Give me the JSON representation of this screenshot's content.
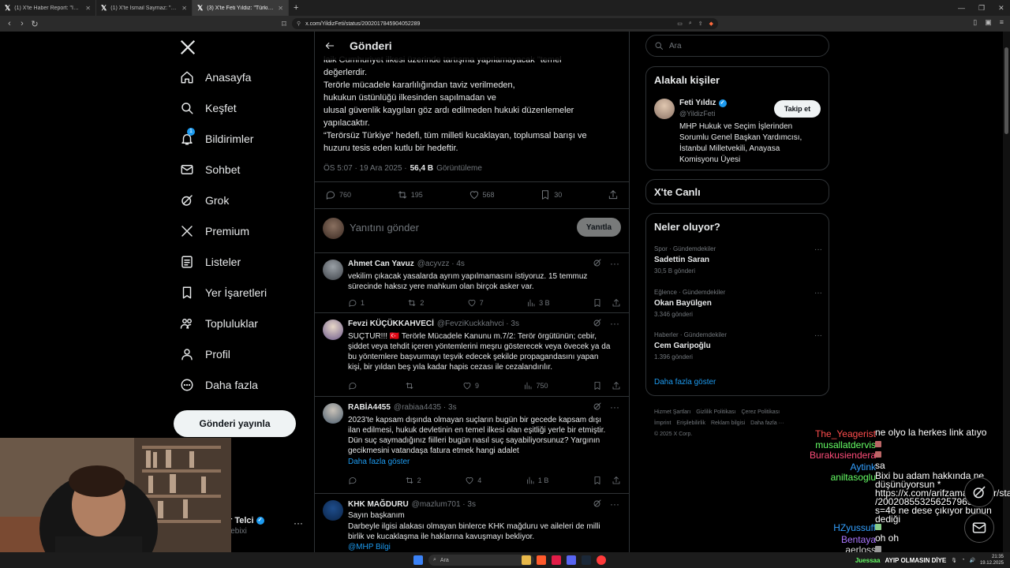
{
  "browser": {
    "tabs": [
      {
        "title": "(1) X'te Haber Report: \"İstanbul Başsavcılığı...",
        "icon": "x-logo-icon"
      },
      {
        "title": "(1) X'te İsmail Saymaz: \"Gaziantep'in...",
        "icon": "x-logo-icon"
      },
      {
        "title": "(3) X'te Feti Yıldız: \"Türkiye'nin dış...",
        "icon": "x-logo-icon",
        "active": true
      }
    ],
    "url": "x.com/YildizFeti/status/2002017845904052289"
  },
  "nav": {
    "items": [
      {
        "label": "Anasayfa",
        "icon": "home-icon"
      },
      {
        "label": "Keşfet",
        "icon": "search-icon"
      },
      {
        "label": "Bildirimler",
        "icon": "bell-icon",
        "badge": "1"
      },
      {
        "label": "Sohbet",
        "icon": "mail-icon"
      },
      {
        "label": "Grok",
        "icon": "grok-icon"
      },
      {
        "label": "Premium",
        "icon": "x-logo-icon"
      },
      {
        "label": "Listeler",
        "icon": "list-icon"
      },
      {
        "label": "Yer İşaretleri",
        "icon": "bookmark-icon"
      },
      {
        "label": "Topluluklar",
        "icon": "people-icon"
      },
      {
        "label": "Profil",
        "icon": "person-icon"
      },
      {
        "label": "Daha fazla",
        "icon": "more-circle-icon"
      }
    ],
    "post_button": "Gönderi yayınla",
    "account": {
      "name": "r Telci",
      "handle": "lebixi"
    }
  },
  "header": {
    "title": "Gönderi"
  },
  "post": {
    "lines": [
      "laik Cumhuriyet ilkesi üzerinde tartışma yapılamayacak \"temel",
      "değerlerdir.",
      "Terörle mücadele kararlılığından taviz verilmeden,",
      "hukukun üstünlüğü ilkesinden sapılmadan ve",
      "ulusal güvenlik kaygıları göz ardı edilmeden hukuki düzenlemeler",
      "yapılacaktır.",
      "“Terörsüz Türkiye” hedefi, tüm milleti kucaklayan, toplumsal barışı ve",
      "huzuru tesis eden kutlu bir hedeftir."
    ],
    "time": "ÖS 5:07 · 19 Ara 2025 ·",
    "views": "56,4 B",
    "views_label": "Görüntüleme",
    "stats": {
      "replies": "760",
      "reposts": "195",
      "likes": "568",
      "bookmarks": "30"
    }
  },
  "reply_box": {
    "placeholder": "Yanıtını gönder",
    "button": "Yanıtla"
  },
  "replies": [
    {
      "name": "Ahmet Can Yavuz",
      "handle": "@acyvzz · 4s",
      "lines": [
        "vekilim çıkacak yasalarda ayrım yapılmamasını istiyoruz. 15 temmuz",
        "sürecinde haksız yere mahkum olan birçok asker var."
      ],
      "more": "",
      "stats": {
        "replies": "1",
        "reposts": "2",
        "likes": "7",
        "views": "3 B"
      }
    },
    {
      "name": "Fevzi KÜÇÜKKAHVECİ",
      "handle": "@FevziKuckkahvci · 3s",
      "lines": [
        "SUÇTUR!!! 🇹🇷 Terörle Mücadele Kanunu m.7/2: Terör örgütünün; cebir,",
        "şiddet veya tehdit içeren yöntemlerini meşru gösterecek veya övecek ya da",
        "bu yöntemlere başvurmayı teşvik edecek şekilde propagandasını yapan",
        "kişi, bir yıldan beş yıla kadar hapis cezası ile cezalandırılır."
      ],
      "more": "",
      "stats": {
        "replies": "",
        "reposts": "",
        "likes": "9",
        "views": "750"
      }
    },
    {
      "name": "RABİA4455",
      "handle": "@rabiaa4435 · 3s",
      "lines": [
        "2023'te kapsam dışında olmayan suçların bugün bir gecede kapsam dışı",
        "ilan edilmesi, hukuk devletinin en temel ilkesi olan eşitliği yerle bir etmiştir.",
        "Dün suç saymadığınız fiilleri bugün nasıl suç sayabiliyorsunuz? Yargının",
        "gecikmesini vatandaşa fatura etmek hangi adalet"
      ],
      "more": "Daha fazla göster",
      "stats": {
        "replies": "",
        "reposts": "2",
        "likes": "4",
        "views": "1 B"
      }
    },
    {
      "name": "KHK MAĞDURU",
      "handle": "@mazlum701 · 3s",
      "lines": [
        "Sayın başkanım",
        "Darbeyle ilgisi alakası olmayan binlerce KHK mağduru ve aileleri de milli",
        "birlik ve kucaklaşma ile haklarına kavuşmayı bekliyor."
      ],
      "more": "@MHP Bilgi",
      "stats": {
        "replies": "",
        "reposts": "",
        "likes": "",
        "views": ""
      }
    }
  ],
  "right": {
    "search_placeholder": "Ara",
    "related_title": "Alakalı kişiler",
    "person": {
      "name": "Feti Yıldız",
      "handle": "@YildizFeti",
      "follow": "Takip et",
      "bio": [
        "MHP Hukuk ve Seçim İşlerinden",
        "Sorumlu Genel Başkan Yardımcısı,",
        "İstanbul Milletvekili, Anayasa",
        "Komisyonu Üyesi"
      ]
    },
    "live_title": "X'te Canlı",
    "trends_title": "Neler oluyor?",
    "trends": [
      {
        "category": "Spor · Gündemdekiler",
        "name": "Sadettin Saran",
        "count": "30,5 B gönderi"
      },
      {
        "category": "Eğlence · Gündemdekiler",
        "name": "Okan Bayülgen",
        "count": "3.346 gönderi"
      },
      {
        "category": "Haberler · Gündemdekiler",
        "name": "Cem Garipoğlu",
        "count": "1.396 gönderi"
      }
    ],
    "show_more": "Daha fazla göster",
    "footer": [
      "Hizmet Şartları",
      "Gizlilik Politikası",
      "Çerez Politikası",
      "İmprint",
      "Erişilebilirlik",
      "Reklam bilgisi",
      "Daha fazla ···",
      "© 2025 X Corp."
    ]
  },
  "chat": [
    {
      "user": "The_Yeagerist",
      "color": "#ff4d4d",
      "msg": "ne olyo la herkes link atıyo"
    },
    {
      "user": "musallatdervis",
      "color": "#66ff66",
      "msg": "[emote]"
    },
    {
      "user": "Burakusiendera",
      "color": "#ff4d7a",
      "msg": "[emote]"
    },
    {
      "user": "Aytink",
      "color": "#33a0ff",
      "msg": "sa"
    },
    {
      "user": "aniltasoglu",
      "color": "#66ff66",
      "msg": "Bixi bu adam hakkında ne düşünüyorsun * https://x.com/arifzamankader/status /2002085532562579651?s=46 ne dese çıkıyor bunun dediği"
    },
    {
      "user": "HZyussuff",
      "color": "#33a0ff",
      "msg": "[emote]"
    },
    {
      "user": "Bentaya",
      "color": "#aa77ff",
      "msg": "oh oh"
    },
    {
      "user": "aerloss",
      "color": "#dddddd",
      "msg": "[emote]"
    },
    {
      "user": "Juessaa",
      "color": "#66ff66",
      "msg": "AYIP OLMASIN DİYE"
    }
  ],
  "taskbar": {
    "search": "Ara",
    "time": "21:35",
    "date": "19.12.2025"
  }
}
